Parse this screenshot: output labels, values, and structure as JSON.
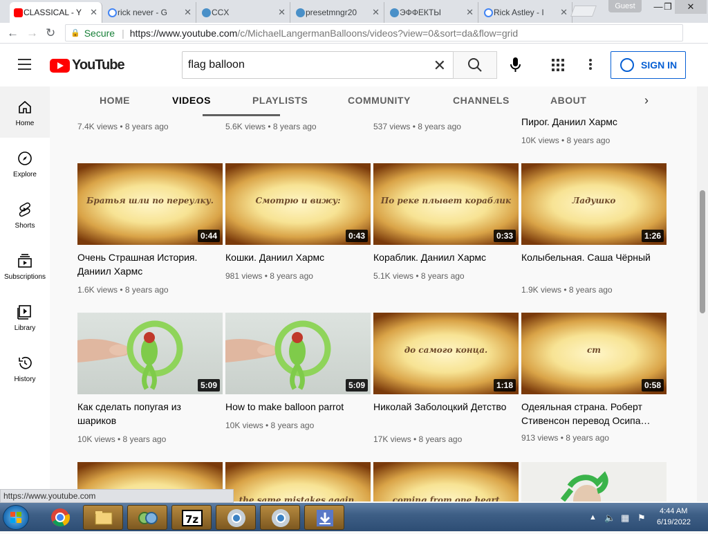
{
  "browser": {
    "tabs": [
      {
        "label": "CLASSICAL - Y",
        "favicon": "youtube-icon",
        "color": "#ff0000"
      },
      {
        "label": "rick never - G",
        "favicon": "google-icon",
        "color": "#4285f4"
      },
      {
        "label": "CCX",
        "favicon": "generic-site-icon",
        "color": "#4a90c8"
      },
      {
        "label": "presetmngr20",
        "favicon": "generic-site-icon",
        "color": "#4a90c8"
      },
      {
        "label": "ЭФФЕКТЫ",
        "favicon": "generic-site-icon",
        "color": "#4a90c8"
      },
      {
        "label": "Rick Astley - I",
        "favicon": "google-icon",
        "color": "#4285f4"
      }
    ],
    "guest_label": "Guest",
    "secure_label": "Secure",
    "url_host": "https://www.youtube.com",
    "url_path": "/c/MichaelLangermanBalloons/videos?view=0&sort=da&flow=grid",
    "status_url": "https://www.youtube.com"
  },
  "header": {
    "logo_text": "YouTube",
    "search_value": "flag balloon",
    "sign_in_label": "SIGN IN"
  },
  "sidebar": {
    "items": [
      {
        "label": "Home",
        "icon": "home-icon"
      },
      {
        "label": "Explore",
        "icon": "compass-icon"
      },
      {
        "label": "Shorts",
        "icon": "shorts-icon"
      },
      {
        "label": "Subscriptions",
        "icon": "subscriptions-icon"
      },
      {
        "label": "Library",
        "icon": "library-icon"
      },
      {
        "label": "History",
        "icon": "history-icon"
      }
    ]
  },
  "channel_tabs": [
    "HOME",
    "VIDEOS",
    "PLAYLISTS",
    "COMMUNITY",
    "CHANNELS",
    "ABOUT"
  ],
  "selected_tab": "VIDEOS",
  "rows": [
    [
      {
        "title": "",
        "meta": "7.4K views • 8 years ago"
      },
      {
        "title": "",
        "meta": "5.6K views • 8 years ago"
      },
      {
        "title": "",
        "meta": "537 views • 8 years ago"
      },
      {
        "title": "Пирог. Даниил Хармс",
        "meta": "10K views • 8 years ago"
      }
    ],
    [
      {
        "caption": "Братья шли по переулку.",
        "duration": "0:44",
        "title": "Очень Страшная История. Даниил Хармс",
        "meta": "1.6K views • 8 years ago",
        "kind": "title"
      },
      {
        "caption": "Смотрю и вижу:",
        "duration": "0:43",
        "title": "Кошки. Даниил Хармс",
        "meta": "981 views • 8 years ago",
        "kind": "title"
      },
      {
        "caption": "По реке плывет кораблик",
        "duration": "0:33",
        "title": "Кораблик. Даниил Хармс",
        "meta": "5.1K views • 8 years ago",
        "kind": "title"
      },
      {
        "caption": "Ладушко",
        "duration": "1:26",
        "title": "Колыбельная. Саша Чёрный",
        "meta": "1.9K views • 8 years ago",
        "kind": "title"
      }
    ],
    [
      {
        "caption": "",
        "duration": "5:09",
        "title": "Как сделать попугая из шариков",
        "meta": "10K views • 8 years ago",
        "kind": "parrot"
      },
      {
        "caption": "",
        "duration": "5:09",
        "title": "How to make balloon parrot",
        "meta": "10K views • 8 years ago",
        "kind": "parrot"
      },
      {
        "caption": "до самого конца.",
        "duration": "1:18",
        "title": "Николай Заболоцкий Детство",
        "meta": "17K views • 8 years ago",
        "kind": "title"
      },
      {
        "caption": "ст",
        "duration": "0:58",
        "title": "Одеяльная страна. Роберт Стивенсон перевод Осипа…",
        "meta": "913 views • 8 years ago",
        "kind": "title"
      }
    ],
    [
      {
        "caption": "",
        "kind": "title"
      },
      {
        "caption": "the same mistakes again.",
        "kind": "title"
      },
      {
        "caption": "coming from one heart",
        "kind": "title"
      },
      {
        "caption": "",
        "kind": "balloon"
      }
    ]
  ],
  "taskbar": {
    "clock_time": "4:44 AM",
    "clock_date": "6/19/2022",
    "apps": [
      "chrome-icon",
      "file-explorer-icon",
      "network-app-icon",
      "7zip-icon",
      "chrome-canary-icon",
      "chrome-icon",
      "download-app-icon"
    ]
  }
}
